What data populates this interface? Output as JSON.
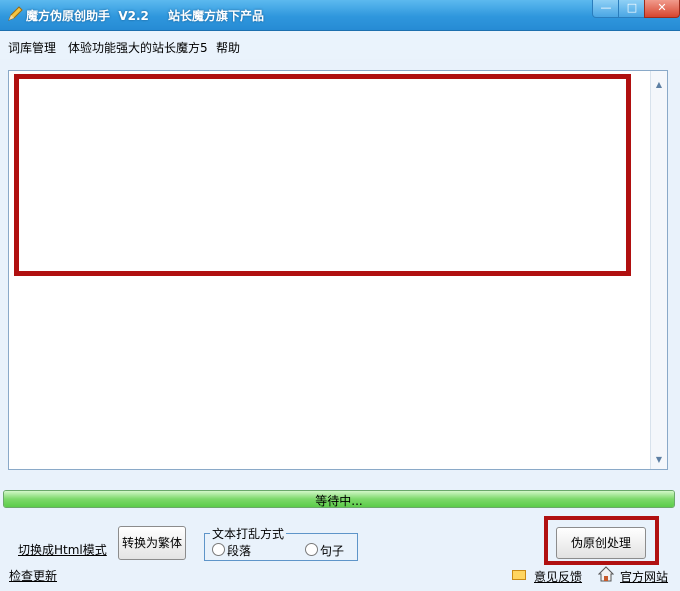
{
  "window": {
    "title": "魔方伪原创助手  V2.2",
    "subtitle": "站长魔方旗下产品",
    "min_icon": "minimize-icon",
    "max_icon": "maximize-icon",
    "close_icon": "close-icon",
    "min_glyph": "—",
    "max_glyph": "□",
    "close_glyph": "✕"
  },
  "menu": {
    "items": [
      "词库管理",
      "体验功能强大的站长魔方5",
      "帮助"
    ]
  },
  "editor": {
    "value": "",
    "up_glyph": "▲",
    "down_glyph": "▼"
  },
  "progress": {
    "label": "等待中...",
    "value": 1.0,
    "fill_color": "#5ccc49"
  },
  "bottom": {
    "html_mode_link": "切换成Html模式",
    "check_update_link": "检查更新",
    "traditional_button": "转换为繁体",
    "shuffle_group_label": "文本打乱方式",
    "shuffle_options": [
      "段落",
      "句子"
    ],
    "process_button": "伪原创处理",
    "feedback_link": "意见反馈",
    "website_link": "官方网站"
  },
  "colors": {
    "titlebar": "#2f97dd",
    "highlight": "#b01010"
  }
}
